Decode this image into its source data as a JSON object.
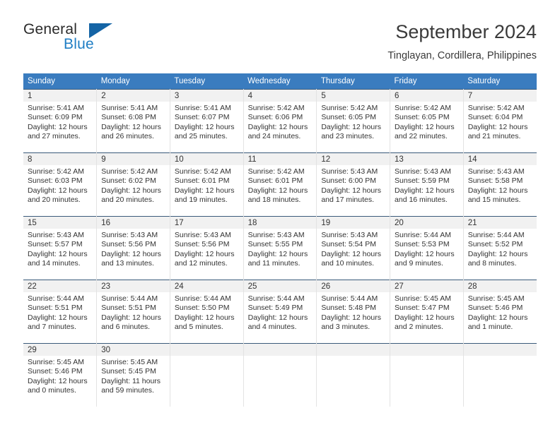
{
  "logo": {
    "word1": "General",
    "word2": "Blue",
    "triangle_color": "#1464a5",
    "blue_color": "#1f7ec4",
    "icon": "triangle-logo-icon"
  },
  "header": {
    "title": "September 2024",
    "subtitle": "Tinglayan, Cordillera, Philippines"
  },
  "theme": {
    "header_row_bg": "#3a7cbf",
    "header_row_text": "#ffffff",
    "daynum_band_bg": "#f1f1f1",
    "row_border": "#3a5a7a",
    "cell_border": "#e3e3e3",
    "text": "#333333"
  },
  "weekdays": [
    "Sunday",
    "Monday",
    "Tuesday",
    "Wednesday",
    "Thursday",
    "Friday",
    "Saturday"
  ],
  "labels": {
    "sunrise_prefix": "Sunrise:",
    "sunset_prefix": "Sunset:",
    "daylight_prefix": "Daylight:"
  },
  "weeks": [
    [
      {
        "day": "1",
        "l1": "Sunrise: 5:41 AM",
        "l2": "Sunset: 6:09 PM",
        "l3": "Daylight: 12 hours",
        "l4": "and 27 minutes."
      },
      {
        "day": "2",
        "l1": "Sunrise: 5:41 AM",
        "l2": "Sunset: 6:08 PM",
        "l3": "Daylight: 12 hours",
        "l4": "and 26 minutes."
      },
      {
        "day": "3",
        "l1": "Sunrise: 5:41 AM",
        "l2": "Sunset: 6:07 PM",
        "l3": "Daylight: 12 hours",
        "l4": "and 25 minutes."
      },
      {
        "day": "4",
        "l1": "Sunrise: 5:42 AM",
        "l2": "Sunset: 6:06 PM",
        "l3": "Daylight: 12 hours",
        "l4": "and 24 minutes."
      },
      {
        "day": "5",
        "l1": "Sunrise: 5:42 AM",
        "l2": "Sunset: 6:05 PM",
        "l3": "Daylight: 12 hours",
        "l4": "and 23 minutes."
      },
      {
        "day": "6",
        "l1": "Sunrise: 5:42 AM",
        "l2": "Sunset: 6:05 PM",
        "l3": "Daylight: 12 hours",
        "l4": "and 22 minutes."
      },
      {
        "day": "7",
        "l1": "Sunrise: 5:42 AM",
        "l2": "Sunset: 6:04 PM",
        "l3": "Daylight: 12 hours",
        "l4": "and 21 minutes."
      }
    ],
    [
      {
        "day": "8",
        "l1": "Sunrise: 5:42 AM",
        "l2": "Sunset: 6:03 PM",
        "l3": "Daylight: 12 hours",
        "l4": "and 20 minutes."
      },
      {
        "day": "9",
        "l1": "Sunrise: 5:42 AM",
        "l2": "Sunset: 6:02 PM",
        "l3": "Daylight: 12 hours",
        "l4": "and 20 minutes."
      },
      {
        "day": "10",
        "l1": "Sunrise: 5:42 AM",
        "l2": "Sunset: 6:01 PM",
        "l3": "Daylight: 12 hours",
        "l4": "and 19 minutes."
      },
      {
        "day": "11",
        "l1": "Sunrise: 5:42 AM",
        "l2": "Sunset: 6:01 PM",
        "l3": "Daylight: 12 hours",
        "l4": "and 18 minutes."
      },
      {
        "day": "12",
        "l1": "Sunrise: 5:43 AM",
        "l2": "Sunset: 6:00 PM",
        "l3": "Daylight: 12 hours",
        "l4": "and 17 minutes."
      },
      {
        "day": "13",
        "l1": "Sunrise: 5:43 AM",
        "l2": "Sunset: 5:59 PM",
        "l3": "Daylight: 12 hours",
        "l4": "and 16 minutes."
      },
      {
        "day": "14",
        "l1": "Sunrise: 5:43 AM",
        "l2": "Sunset: 5:58 PM",
        "l3": "Daylight: 12 hours",
        "l4": "and 15 minutes."
      }
    ],
    [
      {
        "day": "15",
        "l1": "Sunrise: 5:43 AM",
        "l2": "Sunset: 5:57 PM",
        "l3": "Daylight: 12 hours",
        "l4": "and 14 minutes."
      },
      {
        "day": "16",
        "l1": "Sunrise: 5:43 AM",
        "l2": "Sunset: 5:56 PM",
        "l3": "Daylight: 12 hours",
        "l4": "and 13 minutes."
      },
      {
        "day": "17",
        "l1": "Sunrise: 5:43 AM",
        "l2": "Sunset: 5:56 PM",
        "l3": "Daylight: 12 hours",
        "l4": "and 12 minutes."
      },
      {
        "day": "18",
        "l1": "Sunrise: 5:43 AM",
        "l2": "Sunset: 5:55 PM",
        "l3": "Daylight: 12 hours",
        "l4": "and 11 minutes."
      },
      {
        "day": "19",
        "l1": "Sunrise: 5:43 AM",
        "l2": "Sunset: 5:54 PM",
        "l3": "Daylight: 12 hours",
        "l4": "and 10 minutes."
      },
      {
        "day": "20",
        "l1": "Sunrise: 5:44 AM",
        "l2": "Sunset: 5:53 PM",
        "l3": "Daylight: 12 hours",
        "l4": "and 9 minutes."
      },
      {
        "day": "21",
        "l1": "Sunrise: 5:44 AM",
        "l2": "Sunset: 5:52 PM",
        "l3": "Daylight: 12 hours",
        "l4": "and 8 minutes."
      }
    ],
    [
      {
        "day": "22",
        "l1": "Sunrise: 5:44 AM",
        "l2": "Sunset: 5:51 PM",
        "l3": "Daylight: 12 hours",
        "l4": "and 7 minutes."
      },
      {
        "day": "23",
        "l1": "Sunrise: 5:44 AM",
        "l2": "Sunset: 5:51 PM",
        "l3": "Daylight: 12 hours",
        "l4": "and 6 minutes."
      },
      {
        "day": "24",
        "l1": "Sunrise: 5:44 AM",
        "l2": "Sunset: 5:50 PM",
        "l3": "Daylight: 12 hours",
        "l4": "and 5 minutes."
      },
      {
        "day": "25",
        "l1": "Sunrise: 5:44 AM",
        "l2": "Sunset: 5:49 PM",
        "l3": "Daylight: 12 hours",
        "l4": "and 4 minutes."
      },
      {
        "day": "26",
        "l1": "Sunrise: 5:44 AM",
        "l2": "Sunset: 5:48 PM",
        "l3": "Daylight: 12 hours",
        "l4": "and 3 minutes."
      },
      {
        "day": "27",
        "l1": "Sunrise: 5:45 AM",
        "l2": "Sunset: 5:47 PM",
        "l3": "Daylight: 12 hours",
        "l4": "and 2 minutes."
      },
      {
        "day": "28",
        "l1": "Sunrise: 5:45 AM",
        "l2": "Sunset: 5:46 PM",
        "l3": "Daylight: 12 hours",
        "l4": "and 1 minute."
      }
    ],
    [
      {
        "day": "29",
        "l1": "Sunrise: 5:45 AM",
        "l2": "Sunset: 5:46 PM",
        "l3": "Daylight: 12 hours",
        "l4": "and 0 minutes."
      },
      {
        "day": "30",
        "l1": "Sunrise: 5:45 AM",
        "l2": "Sunset: 5:45 PM",
        "l3": "Daylight: 11 hours",
        "l4": "and 59 minutes."
      },
      {
        "day": "",
        "l1": "",
        "l2": "",
        "l3": "",
        "l4": ""
      },
      {
        "day": "",
        "l1": "",
        "l2": "",
        "l3": "",
        "l4": ""
      },
      {
        "day": "",
        "l1": "",
        "l2": "",
        "l3": "",
        "l4": ""
      },
      {
        "day": "",
        "l1": "",
        "l2": "",
        "l3": "",
        "l4": ""
      },
      {
        "day": "",
        "l1": "",
        "l2": "",
        "l3": "",
        "l4": ""
      }
    ]
  ]
}
